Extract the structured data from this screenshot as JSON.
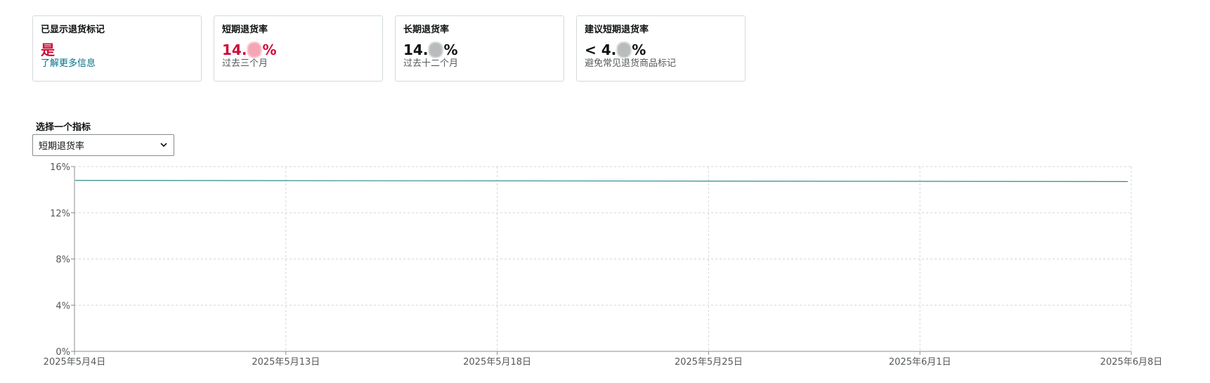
{
  "cards": [
    {
      "title": "已显示退货标记",
      "value": "是",
      "sub": "了解更多信息",
      "sub_is_link": true,
      "value_color": "#cc0c39"
    },
    {
      "title": "短期退货率",
      "value_prefix": "14.",
      "value_suffix": "%",
      "sub": "过去三个月",
      "value_color": "#cc0c39"
    },
    {
      "title": "长期退货率",
      "value_prefix": "14.",
      "value_suffix": "%",
      "sub": "过去十二个月",
      "value_color": "#0f1111"
    },
    {
      "title": "建议短期退货率",
      "value_prefix": "< 4.",
      "value_suffix": "%",
      "sub": "避免常见退货商品标记",
      "value_color": "#0f1111"
    }
  ],
  "metric_selector": {
    "label": "选择一个指标",
    "selected": "短期退货率"
  },
  "chart_data": {
    "type": "line",
    "x": [
      "2025-05-04",
      "2025-06-08"
    ],
    "x_tick_labels": [
      "2025年5月4日",
      "2025年5月13日",
      "2025年5月18日",
      "2025年5月25日",
      "2025年6月1日",
      "2025年6月8日"
    ],
    "y_tick_labels": [
      "0%",
      "4%",
      "8%",
      "12%",
      "16%"
    ],
    "series": [
      {
        "values": [
          14.8,
          14.7
        ],
        "color": "#2e8b8b"
      }
    ],
    "ylim": [
      0,
      16
    ],
    "grid": true,
    "colors": {
      "line": "#2e8b8b",
      "grid": "#d5d5d5",
      "axis": "#8c8c8c"
    }
  }
}
